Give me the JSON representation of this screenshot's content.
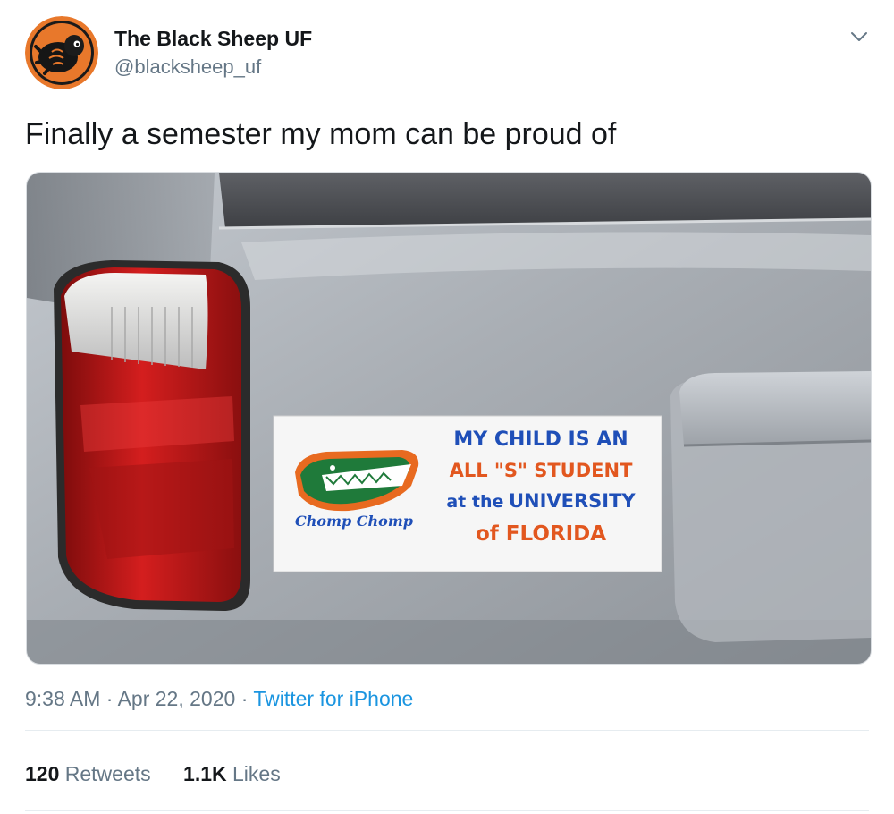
{
  "user": {
    "name": "The Black Sheep UF",
    "handle": "@blacksheep_uf"
  },
  "tweet": {
    "text": "Finally a semester my mom can be proud of"
  },
  "media": {
    "sticker": {
      "line1": "MY CHILD IS AN",
      "line2": "ALL \"S\" STUDENT",
      "line3_prefix": "at the",
      "line3_suffix": "UNIVERSITY",
      "line4": "of FLORIDA",
      "logo_text": "Chomp Chomp"
    }
  },
  "meta": {
    "time": "9:38 AM",
    "separator": "·",
    "date": "Apr 22, 2020",
    "source": "Twitter for iPhone"
  },
  "stats": {
    "retweets_count": "120",
    "retweets_label": "Retweets",
    "likes_count": "1.1K",
    "likes_label": "Likes"
  },
  "colors": {
    "brand_blue": "#1b95e0",
    "muted": "#657786",
    "sticker_blue": "#1f4fb8",
    "sticker_orange": "#e2571f"
  }
}
